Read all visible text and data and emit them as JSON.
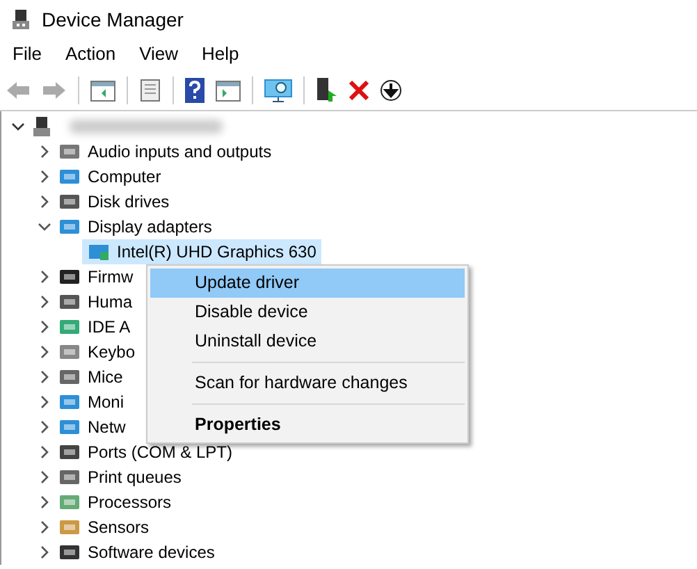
{
  "window": {
    "title": "Device Manager"
  },
  "menu": [
    "File",
    "Action",
    "View",
    "Help"
  ],
  "tree": {
    "expanded": true,
    "children": [
      {
        "label": "Audio inputs and outputs",
        "expanded": false
      },
      {
        "label": "Computer",
        "expanded": false
      },
      {
        "label": "Disk drives",
        "expanded": false
      },
      {
        "label": "Display adapters",
        "expanded": true,
        "children": [
          {
            "label": "Intel(R) UHD Graphics 630",
            "selected": true
          }
        ]
      },
      {
        "label": "Firmw",
        "expanded": false
      },
      {
        "label": "Huma",
        "expanded": false
      },
      {
        "label": "IDE A",
        "expanded": false
      },
      {
        "label": "Keybo",
        "expanded": false
      },
      {
        "label": "Mice",
        "expanded": false
      },
      {
        "label": "Moni",
        "expanded": false
      },
      {
        "label": "Netw",
        "expanded": false
      },
      {
        "label": "Ports (COM & LPT)",
        "expanded": false
      },
      {
        "label": "Print queues",
        "expanded": false
      },
      {
        "label": "Processors",
        "expanded": false
      },
      {
        "label": "Sensors",
        "expanded": false
      },
      {
        "label": "Software devices",
        "expanded": false
      }
    ]
  },
  "context_menu": [
    {
      "kind": "item",
      "label": "Update driver",
      "selected": true,
      "default": false
    },
    {
      "kind": "item",
      "label": "Disable device",
      "selected": false,
      "default": false
    },
    {
      "kind": "item",
      "label": "Uninstall device",
      "selected": false,
      "default": false
    },
    {
      "kind": "separator"
    },
    {
      "kind": "item",
      "label": "Scan for hardware changes",
      "selected": false,
      "default": false
    },
    {
      "kind": "separator"
    },
    {
      "kind": "item",
      "label": "Properties",
      "selected": false,
      "default": true
    }
  ]
}
